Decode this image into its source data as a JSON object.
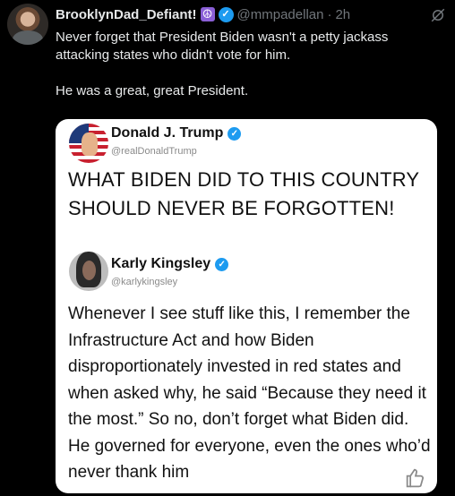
{
  "tweet": {
    "author_name": "BrooklynDad_Defiant!",
    "emoji": "☮",
    "handle": "@mmpadellan",
    "separator": "·",
    "time": "2h",
    "line1": "Never forget that President Biden wasn't a petty jackass attacking states who didn't vote for him.",
    "line2": "He was a great, great President."
  },
  "card": {
    "post1": {
      "name": "Donald J. Trump",
      "handle": "@realDonaldTrump",
      "text": "WHAT BIDEN DID TO THIS COUNTRY SHOULD NEVER BE FORGOTTEN!"
    },
    "post2": {
      "name": "Karly Kingsley",
      "handle": "@karlykingsley",
      "text": "Whenever I see stuff like this, I remember the Infrastructure Act and how Biden disproportionately invested in red states and when asked why, he said “Because they need it the most.” So no, don’t forget what Biden did. He governed for everyone, even the ones who’d never thank him"
    }
  },
  "colors": {
    "background": "#000000",
    "text": "#e7e9ea",
    "muted": "#71767b",
    "verified": "#1d9bf0"
  },
  "icons": [
    "verified-badge-icon",
    "grok-icon",
    "thumbs-up-icon"
  ]
}
